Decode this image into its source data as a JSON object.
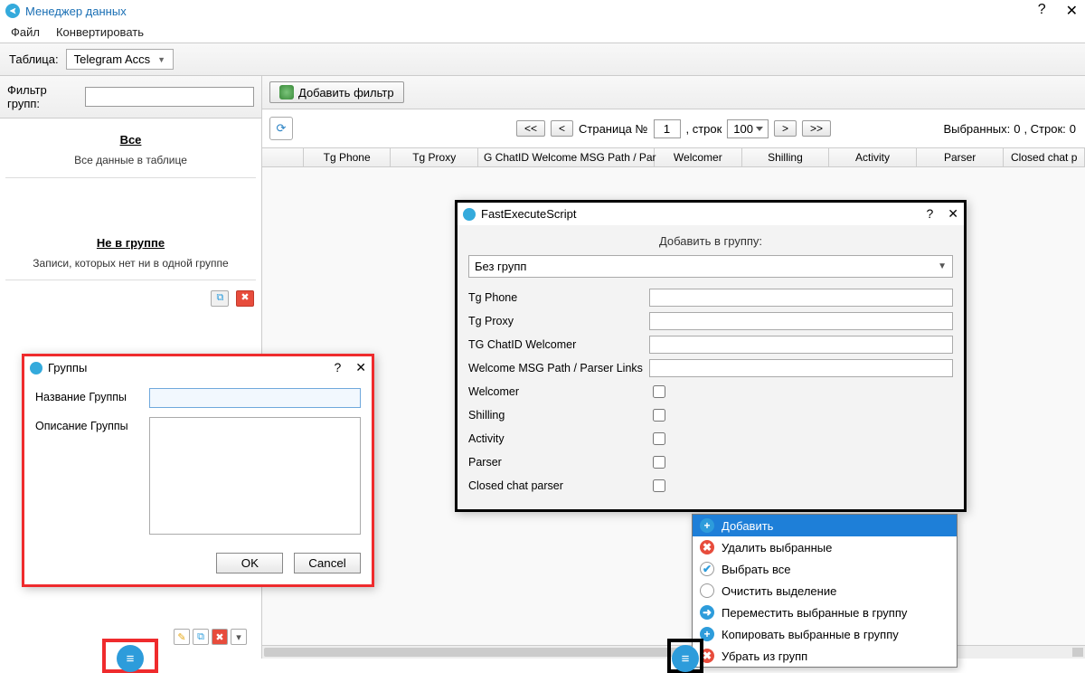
{
  "title": "Менеджер данных",
  "menu": {
    "file": "Файл",
    "convert": "Конвертировать"
  },
  "toolbar": {
    "table_label": "Таблица:",
    "table_value": "Telegram Accs"
  },
  "sidebar": {
    "filter_label": "Фильтр групп:",
    "groups": [
      {
        "title": "Все",
        "desc": "Все данные в таблице"
      },
      {
        "title": "Не в группе",
        "desc": "Записи, которых нет ни в одной группе"
      }
    ]
  },
  "main": {
    "add_filter": "Добавить фильтр",
    "pager": {
      "page_label": "Страница №",
      "page_value": "1",
      "rows_label": ", строк",
      "rows_value": "100"
    },
    "status": {
      "selected_label": "Выбранных:",
      "selected_value": "0",
      "rows_label": ", Строк:",
      "rows_value": "0"
    },
    "columns": [
      "Tg Phone",
      "Tg Proxy",
      "G ChatID Welcome MSG Path / Par",
      "Welcomer",
      "Shilling",
      "Activity",
      "Parser",
      "Closed chat p"
    ]
  },
  "groups_dialog": {
    "title": "Группы",
    "name_label": "Название Группы",
    "desc_label": "Описание Группы",
    "ok": "OK",
    "cancel": "Cancel"
  },
  "fes_dialog": {
    "title": "FastExecuteScript",
    "add_to_group": "Добавить в группу:",
    "group_select": "Без групп",
    "fields_text": [
      "Tg Phone",
      "Tg Proxy",
      "TG ChatID Welcomer",
      "Welcome MSG Path / Parser Links"
    ],
    "fields_check": [
      "Welcomer",
      "Shilling",
      "Activity",
      "Parser",
      "Closed chat parser"
    ]
  },
  "ctx": {
    "items": [
      {
        "label": "Добавить",
        "icon": "plus",
        "selected": true
      },
      {
        "label": "Удалить выбранные",
        "icon": "del"
      },
      {
        "label": "Выбрать все",
        "icon": "check"
      },
      {
        "label": "Очистить выделение",
        "icon": "clear"
      },
      {
        "label": "Переместить выбранные в группу",
        "icon": "move"
      },
      {
        "label": "Копировать выбранные в группу",
        "icon": "copy"
      },
      {
        "label": "Убрать из групп",
        "icon": "remove"
      }
    ]
  }
}
